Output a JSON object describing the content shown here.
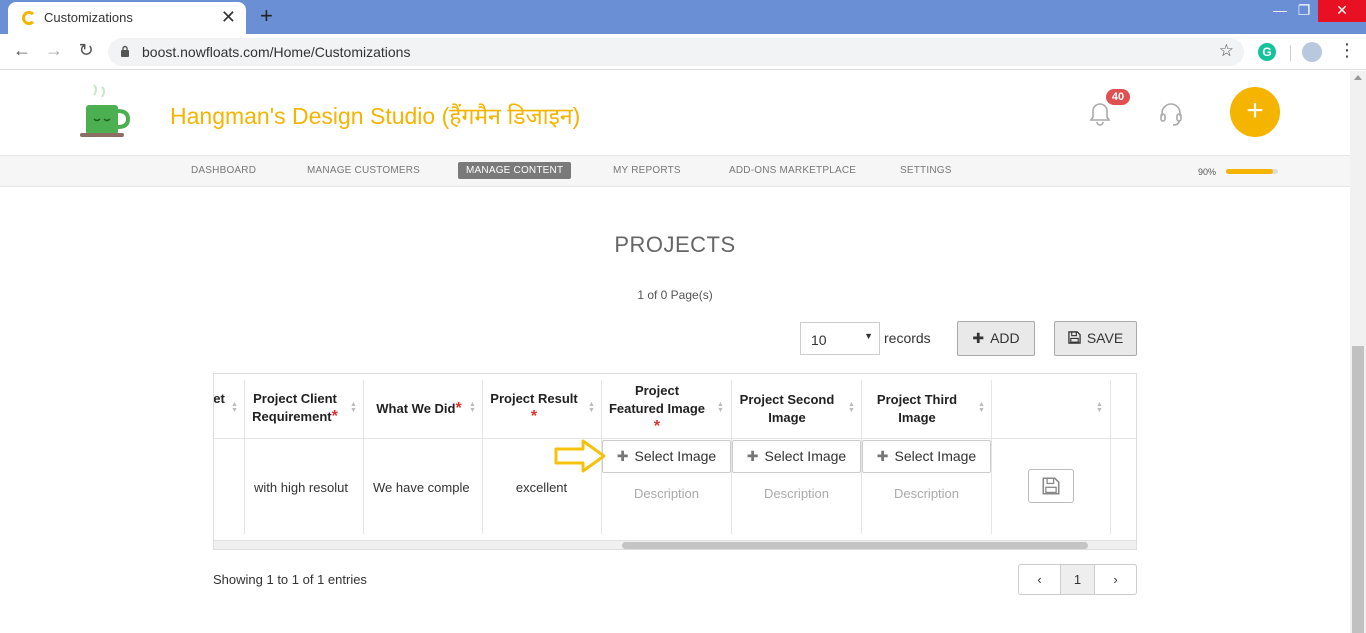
{
  "browser": {
    "tab_title": "Customizations",
    "url": "boost.nowfloats.com/Home/Customizations",
    "new_tab": "+",
    "close_tab": "✕"
  },
  "header": {
    "brand": "Hangman's Design Studio (हैंगमैन डिजाइन)",
    "notification_count": "40",
    "fab_label": "+"
  },
  "nav": {
    "items": [
      "DASHBOARD",
      "MANAGE CUSTOMERS",
      "MANAGE CONTENT",
      "MY REPORTS",
      "ADD-ONS MARKETPLACE",
      "SETTINGS"
    ],
    "active": "MANAGE CONTENT",
    "progress_label": "90%",
    "progress": 0.9
  },
  "content": {
    "title": "PROJECTS",
    "page_info": "1 of 0 Page(s)",
    "records_value": "10",
    "records_label": "records",
    "add_label": "ADD",
    "save_label": "SAVE"
  },
  "table": {
    "headers": {
      "partial": "et",
      "client_req_1": "Project Client",
      "client_req_2": "Requirement",
      "what_we_did": "What We Did",
      "result": "Project Result",
      "featured_1": "Project",
      "featured_2": "Featured Image",
      "second_1": "Project Second",
      "second_2": "Image",
      "third_1": "Project Third",
      "third_2": "Image",
      "required_mark": "*"
    },
    "row": {
      "client_requirement": "with high resolut",
      "what_we_did": "We have comple",
      "result": "excellent",
      "select_image": "Select Image",
      "description": "Description"
    }
  },
  "footer": {
    "showing": "Showing 1 to 1 of 1 entries",
    "prev": "‹",
    "current_page": "1",
    "next": "›"
  },
  "colors": {
    "brand": "#f4b400",
    "tabbar": "#6b8fd4",
    "required": "#e03030"
  }
}
